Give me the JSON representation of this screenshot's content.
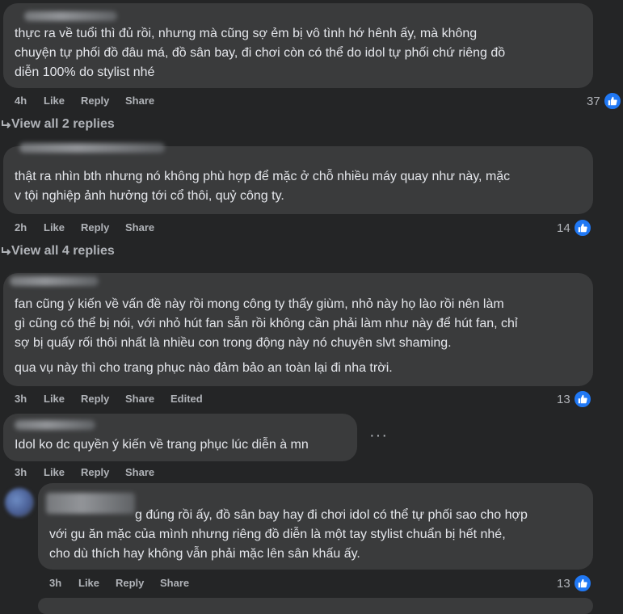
{
  "comments": [
    {
      "lines": [
        "thực ra về tuổi thì đủ rồi, nhưng mà cũng sợ ẻm bị vô tình hớ hênh ấy, mà không",
        "chuyện tự phối đồ đâu má, đồ sân bay, đi chơi còn có thể do idol tự phối chứ riêng đồ",
        "diễn 100% do stylist nhé"
      ],
      "time": "4h",
      "like": "Like",
      "reply": "Reply",
      "share": "Share",
      "reactions": "37"
    },
    {
      "lines": [
        "thật ra nhìn bth nhưng nó không phù hợp để mặc ở chỗ nhiều máy quay như này, mặc",
        "v tội nghiệp ảnh hưởng tới cổ thôi, quỷ công ty."
      ],
      "time": "2h",
      "like": "Like",
      "reply": "Reply",
      "share": "Share",
      "reactions": "14"
    },
    {
      "lines": [
        "fan cũng ý kiến về vấn đề này rồi mong công ty thấy giùm, nhỏ này họ lào rồi nên làm",
        "gì cũng có thể bị nói, với nhỏ hút fan sẵn rồi không cần phải làm như này để hút fan, chỉ",
        "sợ bị quấy rối thôi nhất là nhiều con trong động này nó chuyên slvt shaming."
      ],
      "line4": "qua vụ này thì cho trang phục nào đảm bảo an toàn lại đi nha trời.",
      "time": "3h",
      "like": "Like",
      "reply": "Reply",
      "share": "Share",
      "edited": "Edited",
      "reactions": "13"
    },
    {
      "lines": [
        "Idol ko dc quyền ý kiến về trang phục lúc diễn à mn"
      ],
      "time": "3h",
      "like": "Like",
      "reply": "Reply",
      "share": "Share"
    },
    {
      "lines": [
        "g đúng rồi ấy, đồ sân bay hay đi chơi idol có thể tự phối sao cho hợp",
        "với gu ăn mặc của mình nhưng riêng đồ diễn là một tay stylist chuẩn bị hết nhé,",
        "cho dù thích hay không vẫn phải mặc lên sân khấu ấy."
      ],
      "time": "3h",
      "like": "Like",
      "reply": "Reply",
      "share": "Share",
      "reactions": "13"
    }
  ],
  "view_replies_1": "View all 2 replies",
  "view_replies_2": "View all 4 replies",
  "more_menu": "···",
  "colors": {
    "background": "#242526",
    "bubble": "#3a3b3c",
    "like_blue": "#2078f4",
    "secondary_text": "#b0b3b8"
  }
}
